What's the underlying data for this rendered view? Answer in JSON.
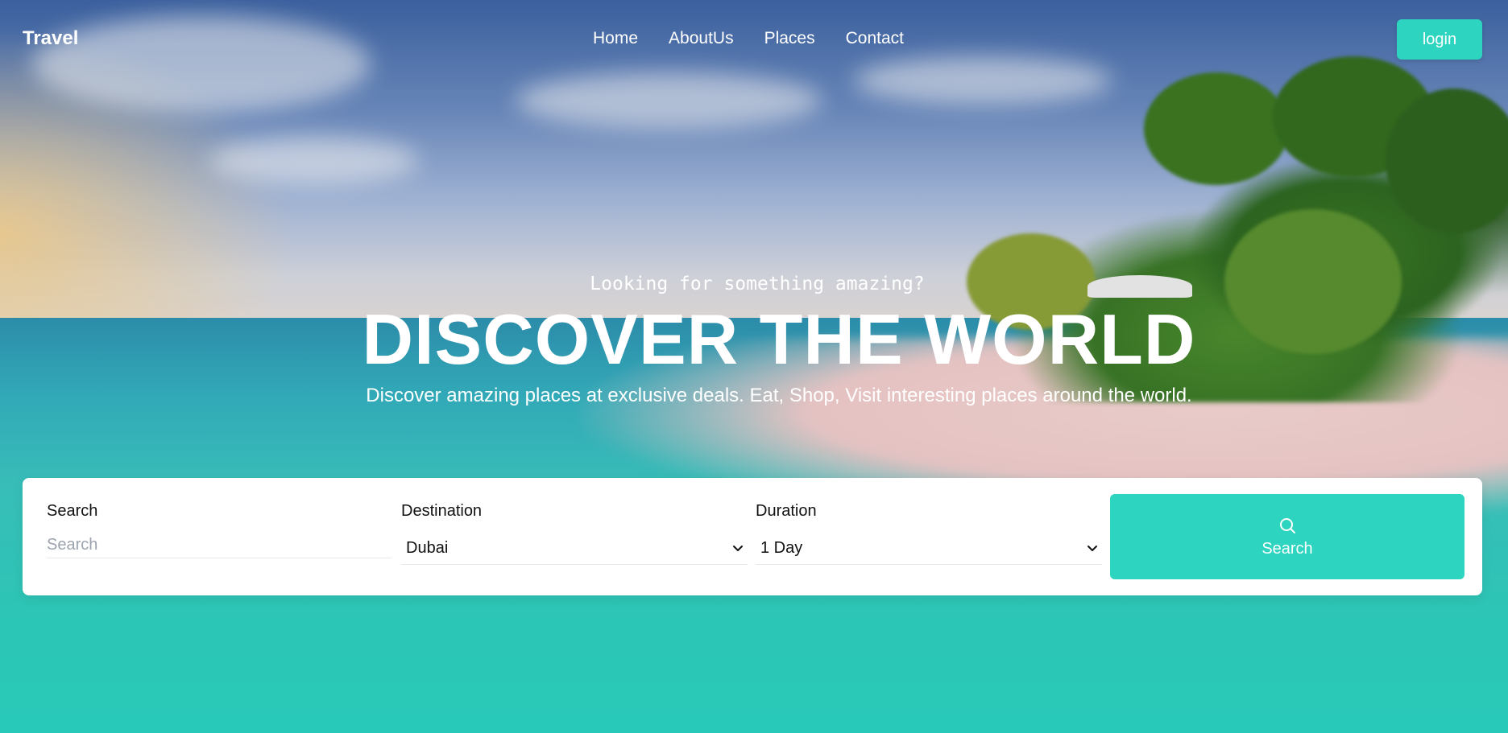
{
  "header": {
    "brand": "Travel",
    "nav": [
      "Home",
      "AboutUs",
      "Places",
      "Contact"
    ],
    "login_label": "login"
  },
  "hero": {
    "tagline": "Looking for something amazing?",
    "title": "DISCOVER THE WORLD",
    "subtitle": "Discover amazing places at exclusive deals. Eat, Shop, Visit interesting places around the world."
  },
  "search_form": {
    "search_label": "Search",
    "search_placeholder": "Search",
    "search_value": "",
    "destination_label": "Destination",
    "destination_value": "Dubai",
    "duration_label": "Duration",
    "duration_value": "1 Day",
    "button_label": "Search"
  },
  "colors": {
    "accent": "#2dd4bf"
  },
  "icons": {
    "search": "search-icon",
    "dropdown": "chevron-down-icon"
  }
}
